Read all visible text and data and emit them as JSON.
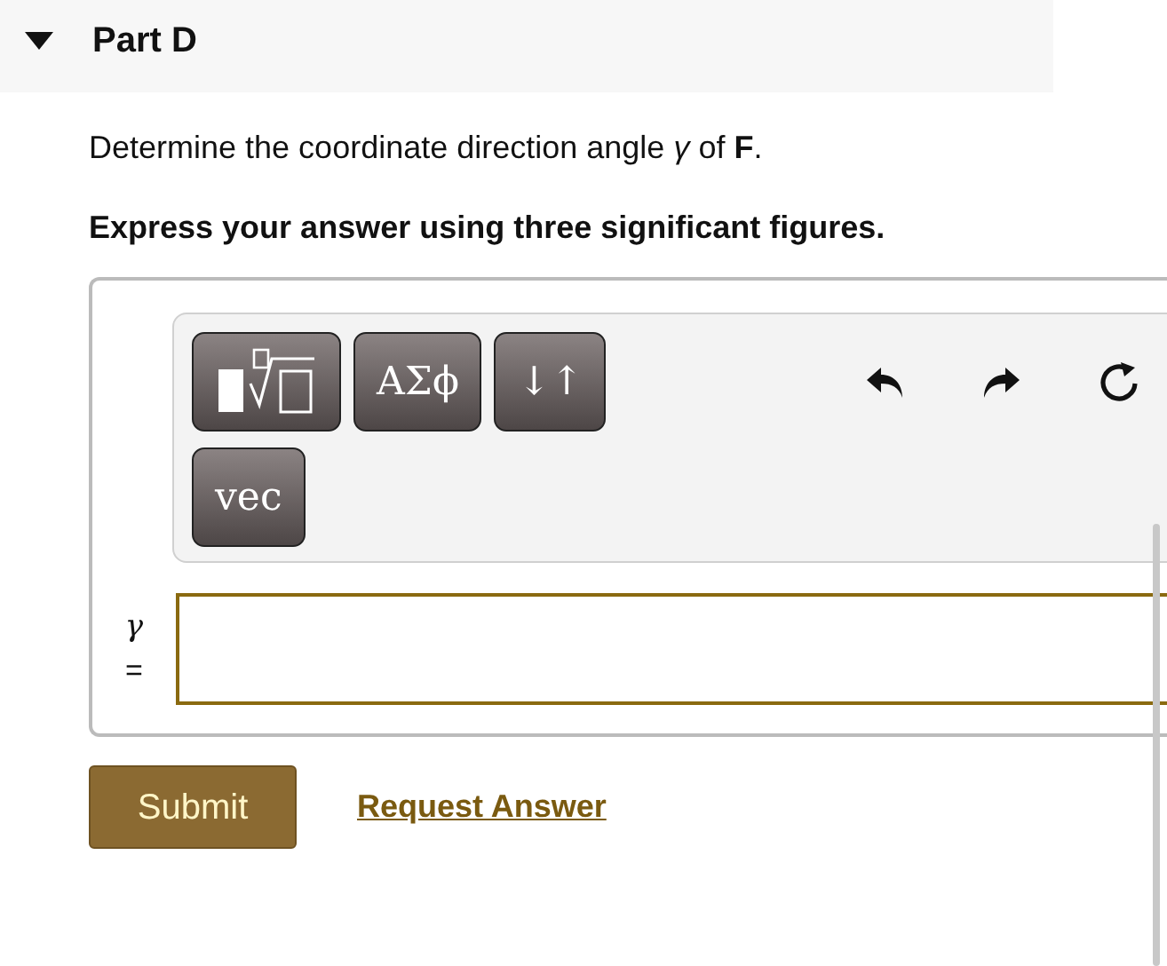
{
  "part": {
    "title": "Part D",
    "expanded": true
  },
  "prompt": "Determine the coordinate direction angle *γ* of **F**.",
  "instruction": "Express your answer using three significant figures.",
  "toolbar": {
    "buttons": [
      {
        "kind": "templates"
      },
      {
        "kind": "text",
        "label": "ΑΣϕ"
      },
      {
        "kind": "text",
        "label": "↓↑"
      },
      {
        "kind": "text",
        "label": "vec"
      }
    ]
  },
  "answer": {
    "label": "γ",
    "equals": "="
  },
  "submit": "Submit",
  "request_answer": "Request Answer"
}
